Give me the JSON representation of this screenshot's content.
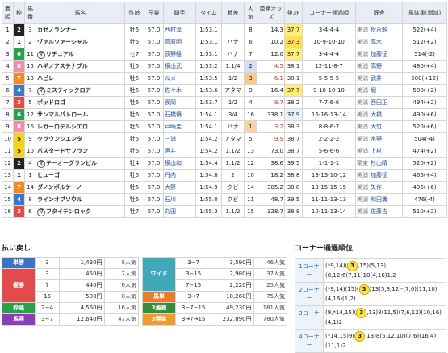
{
  "headers": [
    "着順",
    "枠",
    "馬番",
    "馬名",
    "性齢",
    "斤量",
    "騎手",
    "タイム",
    "着差",
    "人気",
    "単勝オッズ",
    "後3F",
    "コーナー通過順",
    "厩舎",
    "馬体重(増減)"
  ],
  "rows": [
    {
      "rank": "1",
      "frame": "2",
      "num": "3",
      "name": "カゼノランナー",
      "marui": false,
      "sexage": "牡5",
      "wt": "57.0",
      "jockey": "西村淳",
      "time": "1:53.1",
      "margin": "",
      "pop": "8",
      "odds": "14.3",
      "last3": "37.7",
      "corner": "3-4-4-4",
      "region": "美浦",
      "trainer": "松永幹",
      "weight": "522(+4)"
    },
    {
      "rank": "2",
      "frame": "1",
      "num": "2",
      "name": "ヴァルツァーシャル",
      "marui": false,
      "sexage": "牡5",
      "wt": "57.0",
      "jockey": "菅原明",
      "time": "1:53.1",
      "margin": "ハナ",
      "pop": "6",
      "odds": "10.2",
      "last3": "37.3",
      "corner": "10-9-10-10",
      "region": "美浦",
      "trainer": "高木",
      "weight": "512(+2)"
    },
    {
      "rank": "3",
      "frame": "6",
      "num": "11",
      "name": "リチュアル",
      "marui": true,
      "sexage": "セ7",
      "wt": "57.0",
      "jockey": "荻野極",
      "time": "1:53.1",
      "margin": "ハナ",
      "pop": "7",
      "odds": "12.0",
      "last3": "37.7",
      "corner": "3-4-4-4",
      "region": "美浦",
      "trainer": "加藤征",
      "weight": "514(-2)"
    },
    {
      "rank": "4",
      "frame": "8",
      "num": "15",
      "name": "ハギノアステナブル",
      "marui": false,
      "sexage": "牡5",
      "wt": "57.0",
      "jockey": "横山武",
      "time": "1:53.2",
      "margin": "1.1/4",
      "pop": "2",
      "odds": "4.5",
      "last3": "38.1",
      "corner": "12-11-8-7",
      "region": "美浦",
      "trainer": "高野",
      "weight": "480(+4)"
    },
    {
      "rank": "5",
      "frame": "7",
      "num": "13",
      "name": "ハピレ",
      "marui": false,
      "sexage": "牡5",
      "wt": "57.0",
      "jockey": "ルメー",
      "time": "1:53.5",
      "margin": "1/2",
      "pop": "3",
      "odds": "6.1",
      "last3": "38.1",
      "corner": "5-5-5-5",
      "region": "美浦",
      "trainer": "武井",
      "weight": "500(+12)"
    },
    {
      "rank": "6",
      "frame": "4",
      "num": "7",
      "name": "ミスティックロア",
      "marui": true,
      "sexage": "牡5",
      "wt": "57.0",
      "jockey": "佐々木",
      "time": "1:53.6",
      "margin": "アタマ",
      "pop": "9",
      "odds": "16.4",
      "last3": "37.7",
      "corner": "9-10-10-10",
      "region": "美浦",
      "trainer": "堀",
      "weight": "508(+2)"
    },
    {
      "rank": "7",
      "frame": "3",
      "num": "5",
      "name": "ボッドロゴ",
      "marui": false,
      "sexage": "牡5",
      "wt": "57.0",
      "jockey": "長岡",
      "time": "1:53.7",
      "margin": "1/2",
      "pop": "4",
      "odds": "8.7",
      "last3": "38.2",
      "corner": "7-7-6-6",
      "region": "美浦",
      "trainer": "西田正",
      "weight": "494(+2)"
    },
    {
      "rank": "8",
      "frame": "6",
      "num": "12",
      "name": "サンマルパトロール",
      "marui": false,
      "sexage": "牡6",
      "wt": "57.0",
      "jockey": "石橋脩",
      "time": "1:54.1",
      "margin": "3/4",
      "pop": "16",
      "odds": "338.1",
      "last3": "37.9",
      "corner": "16-16-13-14",
      "region": "美浦",
      "trainer": "大橋",
      "weight": "490(+6)"
    },
    {
      "rank": "9",
      "frame": "8",
      "num": "16",
      "name": "レガーロデルシエロ",
      "marui": false,
      "sexage": "牡5",
      "wt": "57.0",
      "jockey": "戸崎圭",
      "time": "1:54.1",
      "margin": "ハナ",
      "pop": "1",
      "odds": "3.2",
      "last3": "38.3",
      "corner": "8-8-6-7",
      "region": "美浦",
      "trainer": "大竹",
      "weight": "520(+6)"
    },
    {
      "rank": "10",
      "frame": "5",
      "num": "9",
      "name": "クラウンシエンタ",
      "marui": false,
      "sexage": "牡5",
      "wt": "57.0",
      "jockey": "三浦",
      "time": "1:54.2",
      "margin": "アタマ",
      "pop": "5",
      "odds": "9.9",
      "last3": "38.7",
      "corner": "2-2-2-2",
      "region": "美浦",
      "trainer": "水野",
      "weight": "504(-4)"
    },
    {
      "rank": "11",
      "frame": "5",
      "num": "10",
      "name": "バスタードサフラン",
      "marui": false,
      "sexage": "牡5",
      "wt": "57.0",
      "jockey": "酒井",
      "time": "1:54.2",
      "margin": "1.1/2",
      "pop": "13",
      "odds": "73.0",
      "last3": "38.7",
      "corner": "5-6-6-6",
      "region": "美浦",
      "trainer": "上村",
      "weight": "474(+2)"
    },
    {
      "rank": "12",
      "frame": "2",
      "num": "4",
      "name": "テーオーグランビル",
      "marui": true,
      "sexage": "牡4",
      "wt": "57.0",
      "jockey": "横山和",
      "time": "1:54.4",
      "margin": "1.1/2",
      "pop": "12",
      "odds": "38.6",
      "last3": "39.5",
      "corner": "1-1-1-1",
      "region": "栗東",
      "trainer": "杉山晴",
      "weight": "520(+2)"
    },
    {
      "rank": "13",
      "frame": "1",
      "num": "1",
      "name": "ヒューゴ",
      "marui": false,
      "sexage": "牡5",
      "wt": "57.0",
      "jockey": "丹内",
      "time": "1:54.8",
      "margin": "2",
      "pop": "10",
      "odds": "18.2",
      "last3": "38.8",
      "corner": "13-13-10-12",
      "region": "美浦",
      "trainer": "加藤征",
      "weight": "466(+4)"
    },
    {
      "rank": "14",
      "frame": "7",
      "num": "14",
      "name": "ダノンポルケーノ",
      "marui": false,
      "sexage": "牡5",
      "wt": "57.0",
      "jockey": "大野",
      "time": "1:54.9",
      "margin": "クビ",
      "pop": "14",
      "odds": "305.2",
      "last3": "38.8",
      "corner": "13-15-15-15",
      "region": "美浦",
      "trainer": "矢作",
      "weight": "496(+6)"
    },
    {
      "rank": "15",
      "frame": "4",
      "num": "8",
      "name": "ラインオブソウル",
      "marui": false,
      "sexage": "牡5",
      "wt": "57.0",
      "jockey": "石川",
      "time": "1:55.0",
      "margin": "クビ",
      "pop": "11",
      "odds": "48.7",
      "last3": "39.5",
      "corner": "11-11-13-13",
      "region": "美浦",
      "trainer": "和田勇",
      "weight": "476(-4)"
    },
    {
      "rank": "16",
      "frame": "3",
      "num": "6",
      "name": "フタイテンロック",
      "marui": true,
      "sexage": "牡7",
      "wt": "57.0",
      "jockey": "丸田",
      "time": "1:55.3",
      "margin": "1.1/2",
      "pop": "15",
      "odds": "328.7",
      "last3": "38.8",
      "corner": "10-11-13-14",
      "region": "美浦",
      "trainer": "佐藤吉",
      "weight": "510(+2)"
    }
  ],
  "payout_title": "払い戻し",
  "payout_left": [
    {
      "label": "単勝",
      "cls": "lab-win",
      "rows": [
        [
          "3",
          "1,430円",
          "8人気"
        ]
      ]
    },
    {
      "label": "複勝",
      "cls": "lab-place",
      "rows": [
        [
          "3",
          "450円",
          "7人気"
        ],
        [
          "7",
          "440円",
          "6人気"
        ],
        [
          "15",
          "500円",
          "8人気"
        ]
      ]
    },
    {
      "label": "枠連",
      "cls": "lab-frame",
      "rows": [
        [
          "2−4",
          "4,560円",
          "16人気"
        ]
      ]
    },
    {
      "label": "馬連",
      "cls": "lab-umaren",
      "rows": [
        [
          "3−7",
          "12,640円",
          "47人気"
        ]
      ]
    }
  ],
  "payout_right": [
    {
      "label": "ワイド",
      "cls": "lab-wide",
      "rows": [
        [
          "3−7",
          "3,590円",
          "46人気"
        ],
        [
          "3−15",
          "2,980円",
          "37人気"
        ],
        [
          "7−15",
          "2,220円",
          "25人気"
        ]
      ]
    },
    {
      "label": "馬単",
      "cls": "lab-umatan",
      "rows": [
        [
          "3→7",
          "18,260円",
          "75人気"
        ]
      ]
    },
    {
      "label": "3連複",
      "cls": "lab-trio",
      "rows": [
        [
          "3−7−15",
          "49,230円",
          "181人気"
        ]
      ]
    },
    {
      "label": "3連単",
      "cls": "lab-tierce",
      "rows": [
        [
          "3→7→15",
          "232,890円",
          "780人気"
        ]
      ]
    }
  ],
  "corner_title": "コーナー通過順位",
  "corners": [
    {
      "label": "1コーナー",
      "pre": "(*9,14)(",
      "hl": "3",
      "post": ",15)(5,13)(8,12)6(7,11)10(4,16)1,2"
    },
    {
      "label": "2コーナー",
      "pre": "(*9,14)(15)(",
      "hl": "3",
      "post": ")13(5,8,12)-(7,6)(11,10)(4,16)(1,2)"
    },
    {
      "label": "3コーナー",
      "pre": "(9,*14,15)(",
      "hl": "3",
      "post": ",13)8(11,5)(7,6,12)(10,16)(4,1)2"
    },
    {
      "label": "4コーナー",
      "pre": "(*14,15)9(",
      "hl": "3",
      "post": ",13)8(5,12,10)(7,6)(16,4)(11,1)2"
    }
  ]
}
